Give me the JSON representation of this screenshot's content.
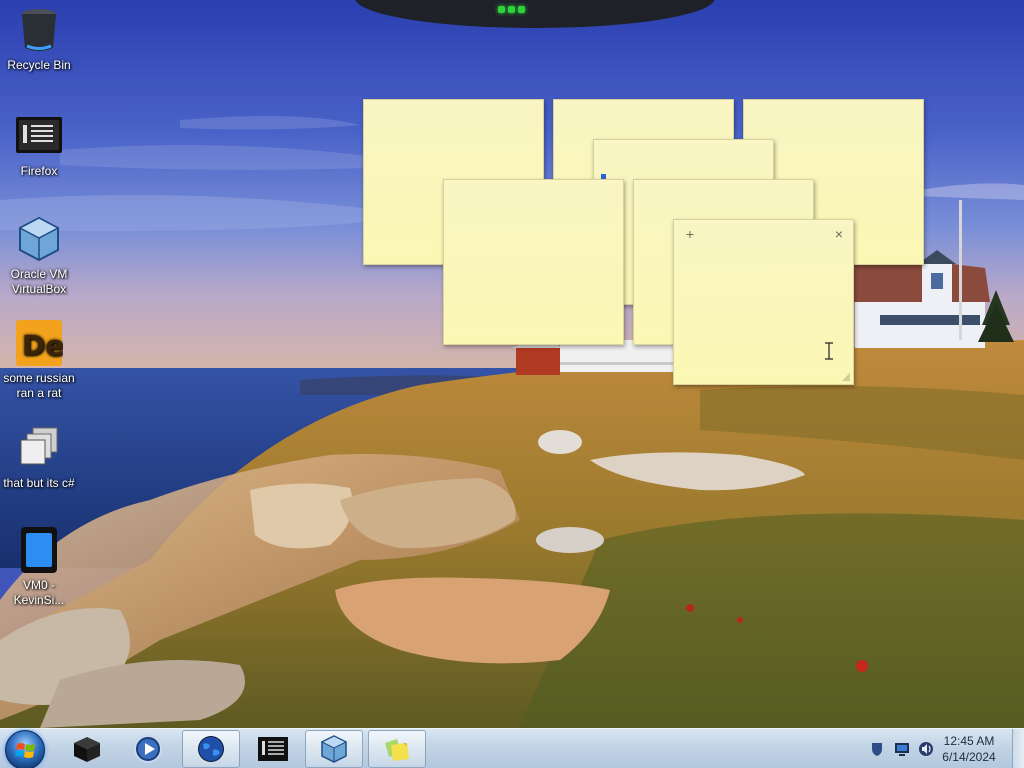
{
  "desktop": {
    "icons": [
      {
        "label": "Recycle Bin",
        "icon": "recycle-bin-icon"
      },
      {
        "label": "Firefox",
        "icon": "firefox-icon"
      },
      {
        "label": "Oracle VM VirtualBox",
        "icon": "virtualbox-icon"
      },
      {
        "label": "some russian ran a rat",
        "icon": "de-app-icon"
      },
      {
        "label": "that but its c#",
        "icon": "stacked-windows-icon"
      },
      {
        "label": "VM0 - KevinSi...",
        "icon": "vm-tablet-icon"
      }
    ]
  },
  "sticky_notes": {
    "color": "#fbf7b3",
    "add_glyph": "+",
    "close_glyph": "×",
    "notes": [
      {
        "text": ""
      },
      {
        "text": ""
      },
      {
        "text": ""
      },
      {
        "text": ""
      },
      {
        "text": ""
      },
      {
        "text": ""
      }
    ]
  },
  "taskbar": {
    "start_button": "windows-start-orb",
    "pinned": [
      {
        "icon": "black-box-app-icon",
        "active": false
      },
      {
        "icon": "media-player-icon",
        "active": false
      },
      {
        "icon": "globe-browser-icon",
        "active": true
      },
      {
        "icon": "terminal-app-icon",
        "active": false
      },
      {
        "icon": "virtualbox-icon",
        "active": true
      },
      {
        "icon": "sticky-notes-icon",
        "active": true
      }
    ],
    "tray": {
      "icons": [
        "action-center-flag-icon",
        "network-monitor-icon",
        "volume-speaker-icon"
      ],
      "time": "12:45 AM",
      "date": "6/14/2024"
    }
  },
  "colors": {
    "taskbar": "#c2d4e6",
    "sky": "#3f55b8",
    "sea": "#1f3f86",
    "accent_caret": "#2a63d6"
  }
}
